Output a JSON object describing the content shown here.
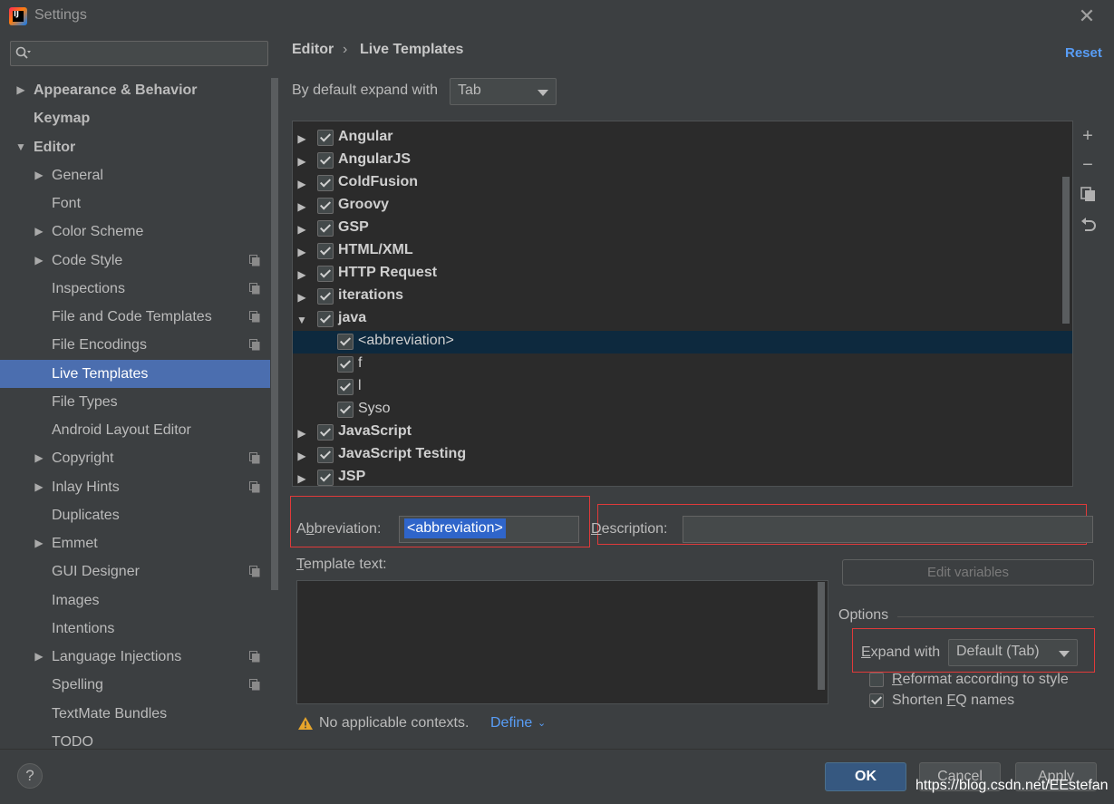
{
  "window": {
    "title": "Settings"
  },
  "sidebar": {
    "items": [
      {
        "label": "Appearance & Behavior",
        "level": 0,
        "arrow": "▶",
        "bold": true,
        "copy": false
      },
      {
        "label": "Keymap",
        "level": 0,
        "arrow": "",
        "bold": true,
        "copy": false
      },
      {
        "label": "Editor",
        "level": 0,
        "arrow": "▼",
        "bold": true,
        "copy": false
      },
      {
        "label": "General",
        "level": 1,
        "arrow": "▶",
        "bold": false,
        "copy": false
      },
      {
        "label": "Font",
        "level": 1,
        "arrow": "",
        "bold": false,
        "copy": false
      },
      {
        "label": "Color Scheme",
        "level": 1,
        "arrow": "▶",
        "bold": false,
        "copy": false
      },
      {
        "label": "Code Style",
        "level": 1,
        "arrow": "▶",
        "bold": false,
        "copy": true
      },
      {
        "label": "Inspections",
        "level": 1,
        "arrow": "",
        "bold": false,
        "copy": true
      },
      {
        "label": "File and Code Templates",
        "level": 1,
        "arrow": "",
        "bold": false,
        "copy": true
      },
      {
        "label": "File Encodings",
        "level": 1,
        "arrow": "",
        "bold": false,
        "copy": true
      },
      {
        "label": "Live Templates",
        "level": 1,
        "arrow": "",
        "bold": false,
        "copy": false,
        "selected": true
      },
      {
        "label": "File Types",
        "level": 1,
        "arrow": "",
        "bold": false,
        "copy": false
      },
      {
        "label": "Android Layout Editor",
        "level": 1,
        "arrow": "",
        "bold": false,
        "copy": false
      },
      {
        "label": "Copyright",
        "level": 1,
        "arrow": "▶",
        "bold": false,
        "copy": true
      },
      {
        "label": "Inlay Hints",
        "level": 1,
        "arrow": "▶",
        "bold": false,
        "copy": true
      },
      {
        "label": "Duplicates",
        "level": 1,
        "arrow": "",
        "bold": false,
        "copy": false
      },
      {
        "label": "Emmet",
        "level": 1,
        "arrow": "▶",
        "bold": false,
        "copy": false
      },
      {
        "label": "GUI Designer",
        "level": 1,
        "arrow": "",
        "bold": false,
        "copy": true
      },
      {
        "label": "Images",
        "level": 1,
        "arrow": "",
        "bold": false,
        "copy": false
      },
      {
        "label": "Intentions",
        "level": 1,
        "arrow": "",
        "bold": false,
        "copy": false
      },
      {
        "label": "Language Injections",
        "level": 1,
        "arrow": "▶",
        "bold": false,
        "copy": true
      },
      {
        "label": "Spelling",
        "level": 1,
        "arrow": "",
        "bold": false,
        "copy": true
      },
      {
        "label": "TextMate Bundles",
        "level": 1,
        "arrow": "",
        "bold": false,
        "copy": false
      },
      {
        "label": "TODO",
        "level": 1,
        "arrow": "",
        "bold": false,
        "copy": false
      }
    ]
  },
  "header": {
    "breadcrumb": [
      "Editor",
      "›",
      "Live Templates"
    ],
    "reset_label": "Reset"
  },
  "expand_default": {
    "label": "By default expand with",
    "value": "Tab"
  },
  "tree": {
    "rows": [
      {
        "label": "Angular",
        "group": true,
        "arrow": "▶",
        "checked": true
      },
      {
        "label": "AngularJS",
        "group": true,
        "arrow": "▶",
        "checked": true
      },
      {
        "label": "ColdFusion",
        "group": true,
        "arrow": "▶",
        "checked": true
      },
      {
        "label": "Groovy",
        "group": true,
        "arrow": "▶",
        "checked": true
      },
      {
        "label": "GSP",
        "group": true,
        "arrow": "▶",
        "checked": true
      },
      {
        "label": "HTML/XML",
        "group": true,
        "arrow": "▶",
        "checked": true
      },
      {
        "label": "HTTP Request",
        "group": true,
        "arrow": "▶",
        "checked": true
      },
      {
        "label": "iterations",
        "group": true,
        "arrow": "▶",
        "checked": true
      },
      {
        "label": "java",
        "group": true,
        "arrow": "▼",
        "checked": true
      },
      {
        "label": "<abbreviation>",
        "group": false,
        "arrow": "",
        "checked": true,
        "selected": true
      },
      {
        "label": "f",
        "group": false,
        "arrow": "",
        "checked": true
      },
      {
        "label": "l",
        "group": false,
        "arrow": "",
        "checked": true
      },
      {
        "label": "Syso",
        "group": false,
        "arrow": "",
        "checked": true
      },
      {
        "label": "JavaScript",
        "group": true,
        "arrow": "▶",
        "checked": true
      },
      {
        "label": "JavaScript Testing",
        "group": true,
        "arrow": "▶",
        "checked": true
      },
      {
        "label": "JSP",
        "group": true,
        "arrow": "▶",
        "checked": true
      }
    ]
  },
  "toolbar": {
    "add_icon": "plus-icon",
    "remove_icon": "minus-icon",
    "copy_icon": "copy-icon",
    "restore_icon": "undo-icon"
  },
  "form": {
    "abbreviation_label_pre": "A",
    "abbreviation_label_mnemonic": "b",
    "abbreviation_label_post": "breviation:",
    "abbreviation_value": "<abbreviation>",
    "description_label_mnemonic": "D",
    "description_label_post": "escription:",
    "description_value": "",
    "template_text_label_mnemonic": "T",
    "template_text_label_post": "emplate text:",
    "template_text_value": "",
    "edit_variables_label": "Edit variables"
  },
  "options": {
    "title": "Options",
    "expand_with_mnemonic": "E",
    "expand_with_post": "xpand with",
    "expand_with_value": "Default (Tab)",
    "reformat_mnemonic": "R",
    "reformat_post": "eformat according to style",
    "reformat_checked": false,
    "shorten_pre": "Shorten ",
    "shorten_mnemonic": "F",
    "shorten_post": "Q names",
    "shorten_checked": true
  },
  "context": {
    "warning_text": "No applicable contexts.",
    "define_label": "Define"
  },
  "footer": {
    "help_label": "?",
    "ok_label": "OK",
    "cancel_label": "Cancel",
    "apply_label": "Apply",
    "watermark": "https://blog.csdn.net/EEstefan"
  },
  "colors": {
    "background": "#3c3f41",
    "selection": "#4b6eaf",
    "tree_selection": "#0d293e",
    "link": "#589df6",
    "highlight_box": "#e03a3a",
    "ok_button": "#365880"
  }
}
